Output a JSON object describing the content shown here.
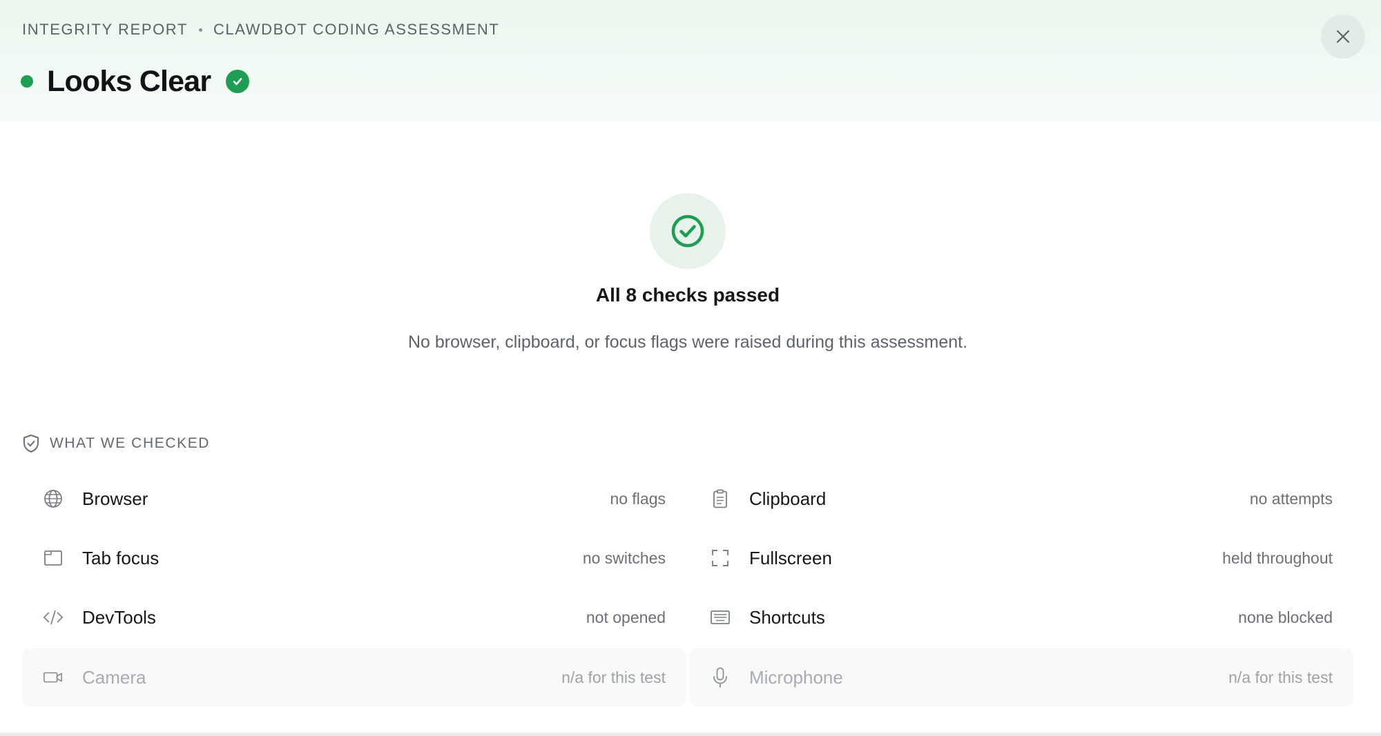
{
  "header": {
    "eyebrow_left": "INTEGRITY REPORT",
    "eyebrow_right": "CLAWDBOT CODING ASSESSMENT",
    "status_title": "Looks Clear",
    "status_color": "#1f9d55",
    "status_icon": "check-circle-icon",
    "close_icon": "close-icon"
  },
  "summary": {
    "icon": "check-circle-icon",
    "title": "All 8 checks passed",
    "text": "No browser, clipboard, or focus flags were raised during this assessment."
  },
  "checks_section": {
    "title": "WHAT WE CHECKED",
    "icon": "shield-check-icon",
    "items": [
      {
        "name": "Browser",
        "status": "no flags",
        "icon": "globe-icon",
        "applicable": true
      },
      {
        "name": "Clipboard",
        "status": "no attempts",
        "icon": "clipboard-icon",
        "applicable": true
      },
      {
        "name": "Tab focus",
        "status": "no switches",
        "icon": "window-icon",
        "applicable": true
      },
      {
        "name": "Fullscreen",
        "status": "held throughout",
        "icon": "fullscreen-icon",
        "applicable": true
      },
      {
        "name": "DevTools",
        "status": "not opened",
        "icon": "code-icon",
        "applicable": true
      },
      {
        "name": "Shortcuts",
        "status": "none blocked",
        "icon": "keyboard-icon",
        "applicable": true
      },
      {
        "name": "Camera",
        "status": "n/a for this test",
        "icon": "camera-icon",
        "applicable": false
      },
      {
        "name": "Microphone",
        "status": "n/a for this test",
        "icon": "microphone-icon",
        "applicable": false
      }
    ]
  }
}
